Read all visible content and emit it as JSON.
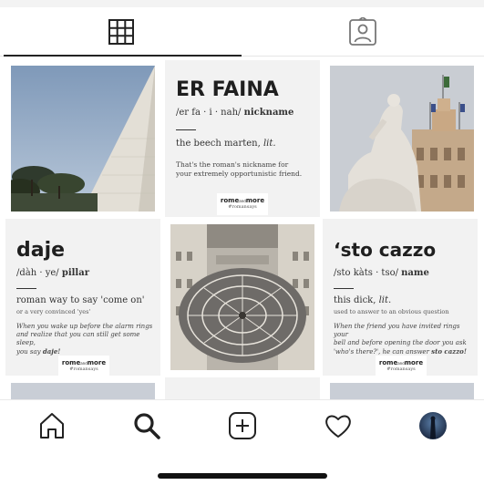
{
  "tabs": [
    {
      "name": "grid-icon"
    },
    {
      "name": "tagged-icon"
    }
  ],
  "posts": {
    "faina": {
      "word": "ER FAINA",
      "phonetic": "/er fa · i · nah/",
      "pos": "nickname",
      "definition": "the beech marten,",
      "definition_tag": "lit.",
      "note_line1": "That's the roman's nickname for",
      "note_line2": "your extremely opportunistic friend.",
      "logo_main": "rome",
      "logo_mid": "and",
      "logo_end": "more",
      "logo_sub": "#romansays"
    },
    "daje": {
      "word": "daje",
      "phonetic": "/dàh · ye/",
      "pos": "pillar",
      "definition": "roman way to say 'come on'",
      "sub": "or a very convinced 'yes'",
      "example_line1": "When you wake up before the alarm rings",
      "example_line2": "and realize that you can still get some sleep,",
      "example_line3": "you say",
      "example_emph": "daje!",
      "logo_main": "rome",
      "logo_mid": "and",
      "logo_end": "more",
      "logo_sub": "#romansays"
    },
    "cazzo": {
      "word": "‘sto cazzo",
      "phonetic": "/sto kàts · tso/",
      "pos": "name",
      "definition": "this dick,",
      "definition_tag": "lit.",
      "sub": "used to answer to an obvious question",
      "example_line1": "When the friend you have invited rings your",
      "example_line2": "bell and before opening the door you ask",
      "example_line3": "'who's there?', he can answer",
      "example_emph": "sto cazzo!",
      "logo_main": "rome",
      "logo_mid": "and",
      "logo_end": "more",
      "logo_sub": "#romansays"
    }
  },
  "images": [
    {
      "name": "pyramid-photo"
    },
    {
      "name": "statue-photo"
    },
    {
      "name": "piazza-aerial-photo"
    }
  ],
  "bottom_nav": [
    {
      "name": "home-icon"
    },
    {
      "name": "search-icon"
    },
    {
      "name": "new-post-icon"
    },
    {
      "name": "activity-heart-icon"
    },
    {
      "name": "profile-avatar"
    }
  ]
}
